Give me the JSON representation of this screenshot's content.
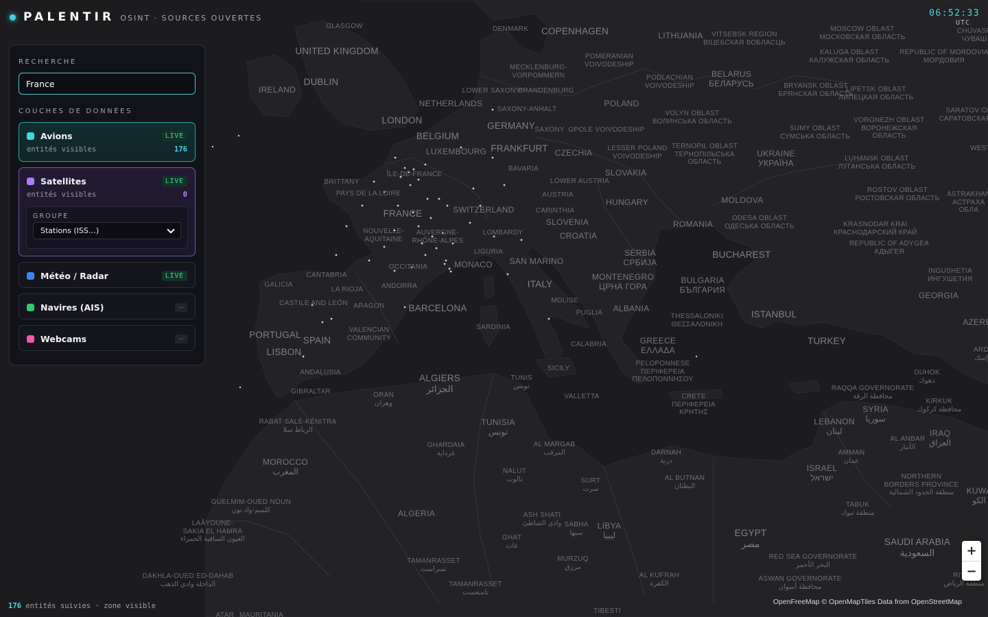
{
  "app": {
    "name": "PALENTIR",
    "subtitle": "OSINT · SOURCES OUVERTES"
  },
  "clock": {
    "time": "06:52:33",
    "timezone": "UTC"
  },
  "search": {
    "title": "RECHERCHE",
    "value": "France"
  },
  "layers_title": "COUCHES DE DONNÉES",
  "layers": [
    {
      "name": "Avions",
      "status": "LIVE",
      "active": true,
      "color": "#3ed6e2",
      "meta_label": "entités visibles",
      "count": "176"
    },
    {
      "name": "Satellites",
      "status": "LIVE",
      "active": true,
      "color": "#b07cf6",
      "meta_label": "entités visibles",
      "count": "0",
      "group": {
        "title": "GROUPE",
        "selected": "Stations (ISS…)"
      }
    },
    {
      "name": "Météo / Radar",
      "status": "LIVE",
      "active": false,
      "color": "#3d86f2"
    },
    {
      "name": "Navires (AIS)",
      "status": "–",
      "active": false,
      "color": "#34c670"
    },
    {
      "name": "Webcams",
      "status": "–",
      "active": false,
      "color": "#f05aa8"
    }
  ],
  "footer": {
    "count": "176",
    "label": "entités suivies · zone visible"
  },
  "zoom": {
    "in": "+",
    "out": "−"
  },
  "attribution": {
    "text": "OpenFreeMap © OpenMapTiles Data from OpenStreetMap"
  },
  "map_labels": [
    "GLASGOW",
    "UNITED KINGDOM",
    "DUBLIN",
    "IRELAND",
    "DENMARK",
    "COPENHAGEN",
    "LITHUANIA",
    "VITSEBSK REGION",
    "ВІЦЕБСКАЯ ВОБЛАСЦЬ",
    "MOSCOW OBLAST",
    "МОСКОВСКАЯ ОБЛАСТЬ",
    "KALUGA OBLAST",
    "КАЛУЖСКАЯ ОБЛАСТЬ",
    "REPUBLIC OF MORDOVIA",
    "МОРДОВИЯ",
    "CHUVASH",
    "ЧУВАШ",
    "POMERANIAN",
    "VOIVODESHIP",
    "MECKLENBURG-",
    "VORPOMMERN",
    "BELARUS",
    "БЕЛАРУСЬ",
    "PODLACHIAN",
    "VOIVODESHIP",
    "BRYANSK OBLAST",
    "БРЯНСКАЯ ОБЛАСТЬ",
    "LIPETSK OBLAST",
    "ЛИПЕЦКАЯ ОБЛАСТЬ",
    "LOWER SAXONY",
    "BRANDENBURG",
    "NETHERLANDS",
    "POLAND",
    "SAXONY-ANHALT",
    "LONDON",
    "SARATOV OB",
    "САРАТОВСКАЯ О",
    "VOLYN OBLAST",
    "ВОЛИНСЬКА ОБЛАСТЬ",
    "VORONEZH OBLAST",
    "ВОРОНЕЖСКАЯ",
    "ОБЛАСТЬ",
    "BELGIUM",
    "GERMANY",
    "SAXONY",
    "OPOLE VOIVODESHIP",
    "SUMY OBLAST",
    "СУМСЬКА ОБЛАСТЬ",
    "LUXEMBOURG",
    "FRANKFURT",
    "LESSER POLAND",
    "VOIVODESHIP",
    "TERNOPIL OBLAST",
    "ТЕРНОПІЛЬСЬКА",
    "ОБЛАСТЬ",
    "CZECHIA",
    "UKRAINE",
    "УКРАЇНА",
    "LUHANSK OBLAST",
    "ЛУГАНСЬКА ОБЛАСТЬ",
    "WEST",
    "BAVARIA",
    "ÎLE-DE-FRANCE",
    "SLOVAKIA",
    "BRITTANY",
    "LOWER AUSTRIA",
    "ROSTOV OBLAST",
    "РОСТОВСКАЯ ОБЛАСТЬ",
    "ASTRAKHAN",
    "АСТРАХА",
    "ОБЛА",
    "PAYS DE LA LOIRE",
    "AUSTRIA",
    "HUNGARY",
    "MOLDOVA",
    "FRANCE",
    "SWITZERLAND",
    "CARINTHIA",
    "ODESA OBLAST",
    "ОДЕСЬКА ОБЛАСТЬ",
    "SLOVENIA",
    "ROMANIA",
    "KRASNODAR KRAI",
    "КРАСНОДАРСКИЙ КРАЙ",
    "REPUBLIC OF ADYGEA",
    "АДЫГЕЯ",
    "NOUVELLE-",
    "AQUITAINE",
    "AUVERGNE-",
    "RHÔNE-ALPES",
    "LOMBARDY",
    "CROATIA",
    "SERBIA",
    "СРБИЈА",
    "BUCHAREST",
    "LIGURIA",
    "SAN MARINO",
    "INGUSHETIA",
    "ИНГУШЕТИЯ",
    "OCCITANIA",
    "MONACO",
    "CANTABRIA",
    "MONTENEGRO",
    "ЦРНА ГОРА",
    "BULGARIA",
    "БЪЛГАРИЯ",
    "GALICIA",
    "ANDORRA",
    "ITALY",
    "LA RIOJA",
    "GEORGIA",
    "CASTILE AND LEÓN",
    "ARAGON",
    "MOLISE",
    "BARCELONA",
    "PUGLIA",
    "ALBANIA",
    "THESSALONIKI",
    "ΘΕΣΣΑΛΟΝΙΚΗ",
    "ISTANBUL",
    "AZERB",
    "VALENCIAN",
    "COMMUNITY",
    "SARDINIA",
    "PORTUGAL",
    "SPAIN",
    "LISBON",
    "CALABRIA",
    "GREECE",
    "ΕΛΛΑΔΑ",
    "TURKEY",
    "ARD",
    "إسك",
    "PELOPONNESE",
    "ΠΕΡΙΦΕΡΕΙΑ",
    "ΠΕΛΟΠΟΝΝΗΣΟΥ",
    "SICILY",
    "DUHOK",
    "دهوك",
    "ANDALUSIA",
    "ALGIERS",
    "الجزائر",
    "TUNIS",
    "تونس",
    "VALLETTA",
    "ORAN",
    "وهران",
    "GIBRALTAR",
    "RAQQA GOVERNORATE",
    "محافظة الرقة",
    "KIRKUK",
    "محافظة كركوك",
    "SYRIA",
    "سوريا",
    "CRETE",
    "ΠΕΡΙΦΕΡΕΙΑ",
    "ΚΡΗΤΗΣ",
    "RABAT-SALÉ-KÉNITRA",
    "الرباط سلا",
    "TUNISIA",
    "تونس",
    "LEBANON",
    "لبنان",
    "IRAQ",
    "العراق",
    "AL ANBAR",
    "الأنبار",
    "GHARDAIA",
    "غرداية",
    "AL MARGAB",
    "المرقب",
    "MOROCCO",
    "المغرب",
    "DARNAH",
    "درنة",
    "AMMAN",
    "عمان",
    "NALUT",
    "نالوت",
    "ISRAEL",
    "ישראל",
    "SURT",
    "سرت",
    "AL BUTNAN",
    "البطنان",
    "NORTHERN",
    "BORDERS PROVINCE",
    "منطقة الحدود الشمالية",
    "KUWA",
    "الكو",
    "GUELMIM-OUED NOUN",
    "كلميم-واد نون",
    "TABUK",
    "منطقة تبوك",
    "ALGERIA",
    "ASH SHATI",
    "وادي الشاطئ",
    "SABHA",
    "سبها",
    "LAÂYOUNE-",
    "SAKIA EL HAMRA",
    "العيون الساقية الحمراء",
    "LIBYA",
    "ليبيا",
    "EGYPT",
    "مصر",
    "GHAT",
    "غات",
    "SAUDI ARABIA",
    "السعودية",
    "RED SEA GOVERNORATE",
    "البحر الأحمر",
    "TAMANRASSET",
    "تمنراست",
    "MURZUQ",
    "مرزق",
    "DAKHLA-OUED ED-DAHAB",
    "الداخلة وادي الذهب",
    "AL KUFRAH",
    "الكفرة",
    "ASWAN GOVERNORATE",
    "محافظة أسوان",
    "RIYAD",
    "منطقة الرياض",
    "TAMANRASSET",
    "تامنغست",
    "TIBESTI",
    "ATAR",
    "MAURITANIA"
  ]
}
